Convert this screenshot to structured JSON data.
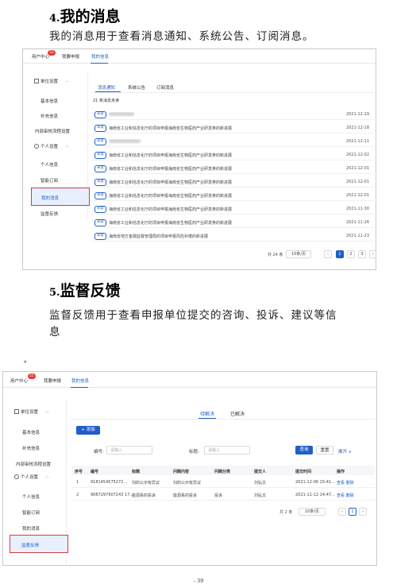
{
  "section4": {
    "num": "4.",
    "title": "我的消息",
    "desc": "我的消息用于查看消息通知、系统公告、订阅消息。"
  },
  "section5": {
    "num": "5.",
    "title": "监督反馈",
    "desc": "监督反馈用于查看申报单位提交的咨询、投诉、建议等信息"
  },
  "bullet": "。",
  "footer_page": "- 39",
  "common_nav": {
    "user_center": "用户中心",
    "badge": "51",
    "my_apply": "我要申报",
    "my_info": "我的信息"
  },
  "sidebar": {
    "unit_settings": "单位设置",
    "basic_info": "基本信息",
    "supplement_info": "补充信息",
    "internal_flow": "内部审核流程设置",
    "personal_settings": "个人设置",
    "personal_info": "个人信息",
    "subscription": "智能订阅",
    "my_messages": "我的消息",
    "feedback": "监督反馈"
  },
  "messages": {
    "tabs": [
      "消息通知",
      "系统公告",
      "订阅消息"
    ],
    "unread_count": "21 条消息未读",
    "tag": "未读",
    "rows": [
      {
        "text": "",
        "blurred": true,
        "date": "2021-12-19"
      },
      {
        "text": "海南省工业和信息化厅的项目申报海南省生物医药产业研发券的新进展",
        "blurred": false,
        "date": "2021-12-18"
      },
      {
        "text": "",
        "blurred": true,
        "date": "2021-12-11"
      },
      {
        "text": "海南省工业和信息化厅的项目申报海南省生物医药产业研发券的新进展",
        "blurred": false,
        "date": "2021-12-02"
      },
      {
        "text": "海南省工业和信息化厅的项目申报海南省生物医药产业研发券的新进展",
        "blurred": false,
        "date": "2021-12-01"
      },
      {
        "text": "海南省工业和信息化厅的项目申报海南省生物医药产业研发券的新进展",
        "blurred": false,
        "date": "2021-12-01"
      },
      {
        "text": "海南省工业和信息化厅的项目申报海南省生物医药产业研发券的新进展",
        "blurred": false,
        "date": "2021-12-01"
      },
      {
        "text": "海南省工业和信息化厅的项目申报海南省生物医药产业研发券的新进展",
        "blurred": false,
        "date": "2021-11-30"
      },
      {
        "text": "海南省工业和信息化厅的项目申报海南省生物医药产业研发券的新进展",
        "blurred": false,
        "date": "2021-11-26"
      },
      {
        "text": "海南省地方金融监督管理局的项目申报风险补偿的新进展",
        "blurred": false,
        "date": "2021-11-23"
      }
    ],
    "pager": {
      "total": "共 24 条",
      "page_size": "10条/页",
      "pages": [
        "1",
        "2",
        "3"
      ],
      "current": "1"
    }
  },
  "feedback_panel": {
    "tabs": [
      "待解决",
      "已解决"
    ],
    "add_button": "+ 添加",
    "filter": {
      "code_label": "编号:",
      "code_placeholder": "请输入",
      "title_label": "标题:",
      "title_placeholder": "请输入",
      "query": "查询",
      "reset": "重置",
      "expand": "展开 ∨"
    },
    "columns": [
      "序号",
      "编号",
      "标题",
      "问题内容",
      "问题分类",
      "提交人",
      "提交时间",
      "操作"
    ],
    "rows": [
      {
        "idx": "1",
        "code": "9181454575272...",
        "title": "刘的公示有异议",
        "content": "刘的公示有异议",
        "category": "",
        "submitter": "刘弘文",
        "time": "2021-12-06 15:41...",
        "ops": "查看 删除"
      },
      {
        "idx": "2",
        "code": "9087297907243 17...",
        "title": "能源系的投诉",
        "content": "能源系的投诉",
        "category": "投诉",
        "submitter": "刘弘文",
        "time": "2021-11-12 14:47...",
        "ops": "查看 删除"
      }
    ],
    "pager": {
      "total": "共 2 条",
      "page_size": "10条/页",
      "current": "1"
    }
  }
}
